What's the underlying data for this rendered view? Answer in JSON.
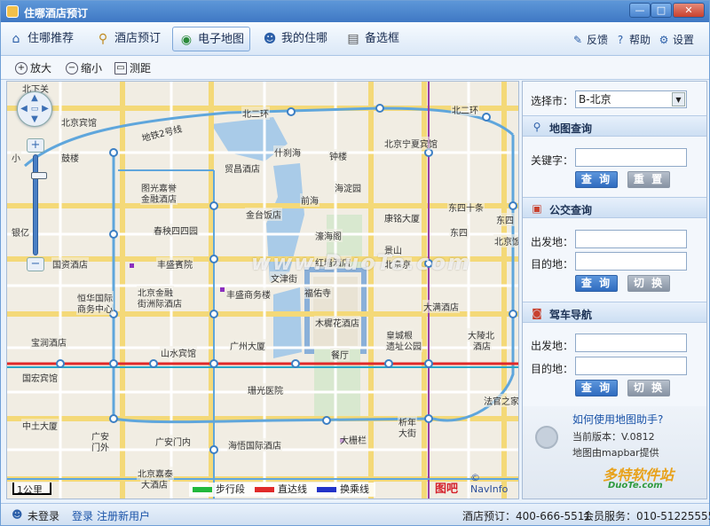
{
  "window": {
    "title": "住哪酒店预订",
    "buttons": {
      "minimize": "—",
      "maximize": "□",
      "close": "✕"
    }
  },
  "nav": {
    "items": [
      {
        "label": "住哪推荐",
        "icon": "house-icon"
      },
      {
        "label": "酒店预订",
        "icon": "magnifier-icon"
      },
      {
        "label": "电子地图",
        "icon": "globe-icon",
        "active": true
      },
      {
        "label": "我的住哪",
        "icon": "user-icon"
      },
      {
        "label": "备选框",
        "icon": "cart-icon"
      }
    ],
    "utils": [
      {
        "label": "反馈",
        "icon": "feedback-icon"
      },
      {
        "label": "帮助",
        "icon": "help-icon"
      },
      {
        "label": "设置",
        "icon": "gear-icon"
      }
    ]
  },
  "toolbar": {
    "zoom_in": "放大",
    "zoom_out": "缩小",
    "measure": "测距"
  },
  "map": {
    "labels": [
      "北下关",
      "北二环",
      "北二环",
      "地铁2号线",
      "北京宁夏宾馆",
      "什刹海",
      "钟楼",
      "贸昌酒店",
      "图光嘉誉",
      "金融酒店",
      "前海",
      "海淀园",
      "东四十条",
      "金台饭店",
      "春秧四四园",
      "康铭大厦",
      "东四",
      "濠海阁",
      "景山",
      "丰盛賓院",
      "北京京",
      "红墙酒店",
      "文津街",
      "丰盛商务楼",
      "福佑寺",
      "北京金融",
      "街洲际酒店",
      "大满酒店",
      "恒华国际",
      "商务中心",
      "木樨花酒店",
      "宝润酒店",
      "皇城根",
      "遗址公园",
      "大陵北",
      "酒店",
      "山水宾馆",
      "广州大厦",
      "餐厅",
      "国宏宾馆",
      "珊光医院",
      "中土大厦",
      "广安门内",
      "海悟国际酒店",
      "大栅栏",
      "广安",
      "门外",
      "北京嘉泰",
      "大酒店",
      "法官之家",
      "析年",
      "大街",
      "小",
      "国资酒店",
      "银亿",
      "鼓楼",
      "北京宾馆",
      "东四",
      "北京饭"
    ],
    "scale": "1公里",
    "legend": [
      {
        "label": "步行段",
        "color": "#22b83c"
      },
      {
        "label": "直达线",
        "color": "#e02a2a"
      },
      {
        "label": "换乘线",
        "color": "#2233c8"
      }
    ],
    "brand": "图吧",
    "copyright": "© NavInfo",
    "watermark": "www.DuoTe.com",
    "zoom_level": 0.18
  },
  "panel": {
    "city_label": "选择市：",
    "city_value": "B-北京",
    "map_search": {
      "title": "地图查询",
      "keyword_label": "关键字：",
      "query": "查 询",
      "reset": "重 置"
    },
    "bus": {
      "title": "公交查询",
      "from_label": "出发地：",
      "to_label": "目的地：",
      "query": "查 询",
      "switch": "切 换"
    },
    "drive": {
      "title": "驾车导航",
      "from_label": "出发地：",
      "to_label": "目的地：",
      "query": "查 询",
      "switch": "切 换"
    },
    "help": {
      "link": "如何使用地图助手?",
      "version": "当前版本：V.0812",
      "provider": "地图由mapbar提供",
      "wm1": "多特软件站",
      "wm2": "DuoTe.com"
    }
  },
  "status": {
    "login_state": "未登录",
    "login": "登录",
    "register": "注册新用户",
    "hotline": "酒店预订：400-666-5511",
    "service": "会员服务：010-51225555"
  },
  "colors": {
    "accent": "#3f78c4",
    "subway2": "#4aa0d8",
    "red_line": "#e02a2a"
  }
}
